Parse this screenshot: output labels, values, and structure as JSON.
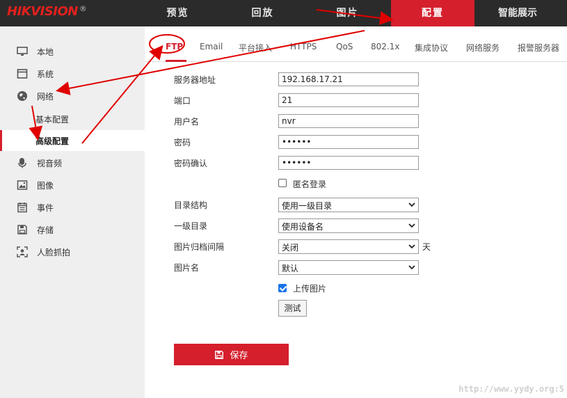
{
  "brand": {
    "name": "HIKVISION",
    "mark": "®"
  },
  "top_nav": [
    "预览",
    "回放",
    "图片",
    "配置",
    "智能展示"
  ],
  "top_nav_active": "配置",
  "sidebar": {
    "items": [
      {
        "label": "本地",
        "icon": "monitor-icon"
      },
      {
        "label": "系统",
        "icon": "system-window-icon"
      },
      {
        "label": "网络",
        "icon": "globe-icon"
      },
      {
        "label": "基本配置",
        "sub": true
      },
      {
        "label": "高级配置",
        "sub": true,
        "active": true
      },
      {
        "label": "视音频",
        "icon": "microphone-icon"
      },
      {
        "label": "图像",
        "icon": "image-icon"
      },
      {
        "label": "事件",
        "icon": "calendar-icon"
      },
      {
        "label": "存储",
        "icon": "save-disk-icon"
      },
      {
        "label": "人脸抓拍",
        "icon": "face-capture-icon"
      }
    ]
  },
  "tabs": [
    "FTP",
    "Email",
    "平台接入",
    "HTTPS",
    "QoS",
    "802.1x",
    "集成协议",
    "网络服务",
    "报警服务器"
  ],
  "active_tab": "FTP",
  "form": {
    "server_label": "服务器地址",
    "server_value": "192.168.17.21",
    "port_label": "端口",
    "port_value": "21",
    "user_label": "用户名",
    "user_value": "nvr",
    "password_label": "密码",
    "password_value": "••••••",
    "confirm_label": "密码确认",
    "confirm_value": "••••••",
    "anonymous_label": "匿名登录",
    "anonymous_checked": false,
    "dir_structure_label": "目录结构",
    "dir_structure_value": "使用一级目录",
    "parent_dir_label": "一级目录",
    "parent_dir_value": "使用设备名",
    "archive_interval_label": "图片归档间隔",
    "archive_interval_value": "关闭",
    "archive_interval_unit": "天",
    "picture_name_label": "图片名",
    "picture_name_value": "默认",
    "upload_label": "上传图片",
    "upload_checked": true,
    "test_label": "测试",
    "save_label": "保存"
  },
  "watermark": "http://www.yydy.org:5",
  "colors": {
    "accent": "#d51f2c",
    "topbar": "#2b2b2b",
    "sidebar": "#efefef",
    "annotation": "#e00000"
  }
}
